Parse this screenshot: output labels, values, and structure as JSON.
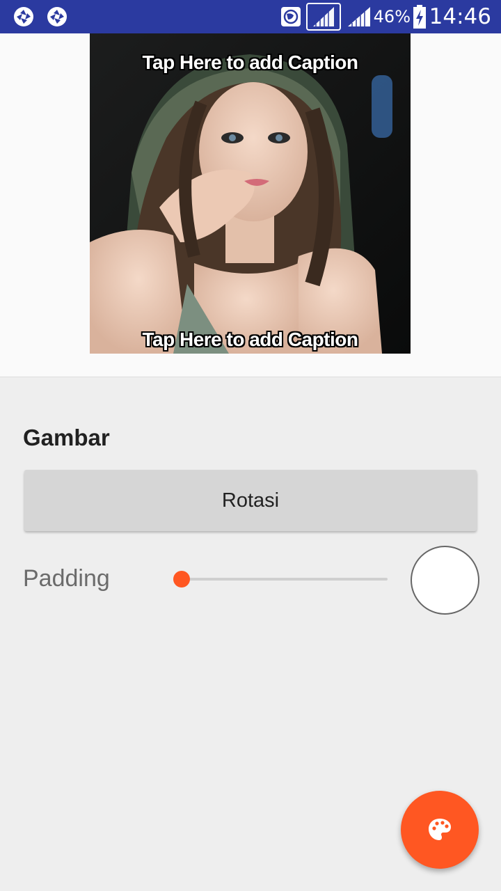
{
  "status_bar": {
    "battery": "46%",
    "time": "14:46",
    "left_icons": [
      "camera-shutter-icon",
      "camera-shutter-icon"
    ],
    "right_icons": [
      "globe-icon",
      "signal-icon",
      "signal-icon",
      "battery-charging-icon"
    ]
  },
  "meme": {
    "top_caption": "Tap Here to add Caption",
    "bottom_caption": "Tap Here to add Caption"
  },
  "controls": {
    "section_title": "Gambar",
    "rotate_label": "Rotasi",
    "padding_label": "Padding",
    "padding_value_fraction": 0.0,
    "background_color": "#ffffff"
  },
  "fab": {
    "icon": "palette-icon"
  },
  "colors": {
    "status_bar": "#2b3aa0",
    "accent": "#ff5722",
    "button": "#d6d6d6",
    "background": "#eeeeee"
  }
}
